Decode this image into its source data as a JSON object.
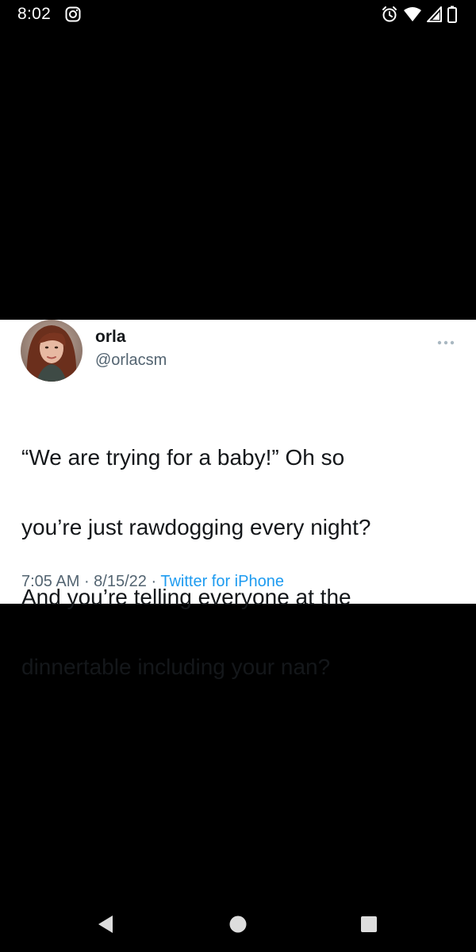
{
  "status_bar": {
    "time": "8:02",
    "icons": [
      "instagram-icon",
      "alarm-icon",
      "wifi-icon",
      "signal-icon",
      "battery-icon"
    ]
  },
  "tweet": {
    "display_name": "orla",
    "handle": "@orlacsm",
    "text_lines": [
      "“We are trying for a baby!” Oh so",
      "you’re just rawdogging every night?",
      "And you’re telling everyone at the",
      "dinnertable including your nan?"
    ],
    "time": "7:05 AM",
    "date": "8/15/22",
    "separator": " · ",
    "source": "Twitter for iPhone"
  },
  "nav_bar": {
    "buttons": [
      "back-icon",
      "home-icon",
      "recents-icon"
    ]
  },
  "colors": {
    "background": "#000000",
    "card": "#ffffff",
    "text": "#14171a",
    "secondary": "#536471",
    "link": "#1d9bf0"
  }
}
